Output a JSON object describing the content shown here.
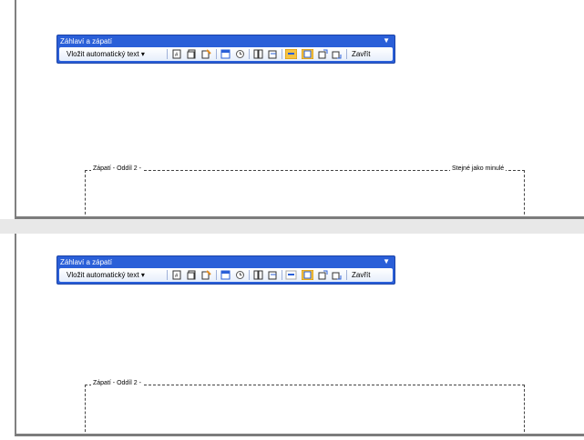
{
  "toolbar": {
    "title": "Záhlaví a zápatí",
    "insert_autotext": "Vložit automatický text",
    "close": "Zavřít"
  },
  "footer": {
    "label": "Zápatí - Oddíl 2 -",
    "same_as_previous": "Stejné jako minulé"
  },
  "icons": [
    "insert-page-number-icon",
    "insert-number-of-pages-icon",
    "format-page-number-icon",
    "insert-date-icon",
    "insert-time-icon",
    "page-setup-icon",
    "show-hide-text-icon",
    "link-to-previous-icon",
    "switch-header-footer-icon",
    "show-previous-icon",
    "show-next-icon"
  ]
}
